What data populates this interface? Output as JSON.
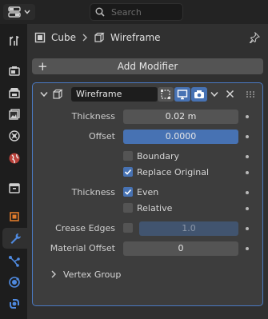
{
  "header": {
    "search_placeholder": "Search"
  },
  "tabs": [
    {
      "name": "tool-tab-icon",
      "active": false
    },
    {
      "name": "render-tab-icon",
      "active": false
    },
    {
      "name": "output-tab-icon",
      "active": false
    },
    {
      "name": "view-layer-tab-icon",
      "active": false
    },
    {
      "name": "scene-tab-icon",
      "active": false
    },
    {
      "name": "world-tab-icon",
      "active": false
    },
    {
      "name": "collection-tab-icon",
      "active": false
    },
    {
      "name": "object-tab-icon",
      "active": false
    },
    {
      "name": "modifier-tab-icon",
      "active": true
    },
    {
      "name": "particles-tab-icon",
      "active": false
    },
    {
      "name": "physics-tab-icon",
      "active": false
    },
    {
      "name": "constraints-tab-icon",
      "active": false
    }
  ],
  "breadcrumb": {
    "object": "Cube",
    "modifier": "Wireframe"
  },
  "add_modifier": "Add Modifier",
  "modifier": {
    "name": "Wireframe",
    "thickness_label": "Thickness",
    "thickness_value": "0.02 m",
    "offset_label": "Offset",
    "offset_value": "0.0000",
    "boundary_label": "Boundary",
    "boundary_checked": false,
    "replace_original_label": "Replace Original",
    "replace_original_checked": true,
    "thickness2_label": "Thickness",
    "even_label": "Even",
    "even_checked": true,
    "relative_label": "Relative",
    "relative_checked": false,
    "crease_edges_label": "Crease Edges",
    "crease_edges_checked": false,
    "crease_weight": "1.0",
    "material_offset_label": "Material Offset",
    "material_offset_value": "0",
    "vertex_group_label": "Vertex Group"
  },
  "colors": {
    "accent": "#4772b3",
    "active_outline": "#4a79c2",
    "panel_bg": "#303030",
    "modifier_bg": "#3d3d3d"
  }
}
